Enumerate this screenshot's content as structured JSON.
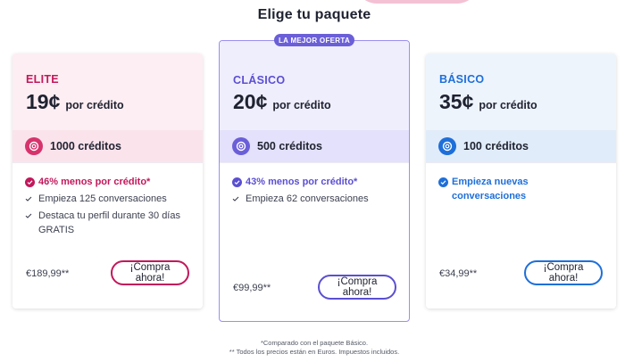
{
  "page": {
    "title": "Elige tu paquete"
  },
  "colors": {
    "elite_accent": "#c2185b",
    "clasico_accent": "#5b4fd1",
    "basico_accent": "#1e6fd9",
    "badge_bg": "#6b5fd8"
  },
  "plans": [
    {
      "tier": "ELITE",
      "price": "19¢",
      "per": "por crédito",
      "credits": "1000 créditos",
      "coin_icon": "coin-icon",
      "features": [
        {
          "text": "46% menos por crédito*",
          "highlight": true
        },
        {
          "text": "Empieza 125 conversaciones",
          "highlight": false
        },
        {
          "text": "Destaca tu perfil durante 30 días GRATIS",
          "highlight": false
        }
      ],
      "total": "€189,99**",
      "cta": "¡Compra ahora!"
    },
    {
      "tier": "CLÁSICO",
      "badge": "LA MEJOR OFERTA",
      "price": "20¢",
      "per": "por crédito",
      "credits": "500 créditos",
      "coin_icon": "coin-icon",
      "features": [
        {
          "text": "43% menos por crédito*",
          "highlight": true
        },
        {
          "text": "Empieza 62 conversaciones",
          "highlight": false
        }
      ],
      "total": "€99,99**",
      "cta": "¡Compra ahora!"
    },
    {
      "tier": "BÁSICO",
      "price": "35¢",
      "per": "por crédito",
      "credits": "100 créditos",
      "coin_icon": "coin-icon",
      "features": [
        {
          "text": "Empieza nuevas conversaciones",
          "highlight": true
        }
      ],
      "total": "€34,99**",
      "cta": "¡Compra ahora!"
    }
  ],
  "footnotes": {
    "line1": "*Comparado con el paquete Básico.",
    "line2": "** Todos los precios están en Euros. Impuestos incluidos."
  }
}
